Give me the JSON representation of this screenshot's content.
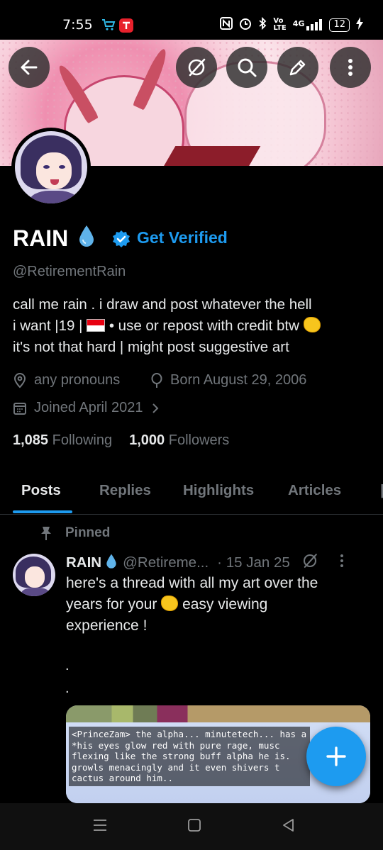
{
  "status_bar": {
    "time": "7:55",
    "network": "4G",
    "battery": "12",
    "icons": [
      "shopping-cart-icon",
      "app-notification-icon",
      "nfc-icon",
      "alarm-icon",
      "bluetooth-icon",
      "volte-icon",
      "signal-icon",
      "battery-icon",
      "charging-icon"
    ]
  },
  "header": {
    "buttons": [
      "back-button",
      "grok-button",
      "search-button",
      "edit-button",
      "more-button"
    ]
  },
  "profile": {
    "name": "RAIN",
    "get_verified": "Get Verified",
    "handle": "@RetirementRain",
    "bio_line1": "call me rain .   i draw and post whatever the hell",
    "bio_line2a": "i want |19 |",
    "bio_line2b": "• use or repost with credit btw",
    "bio_line3": "it's not that hard | might post suggestive art",
    "pronouns": "any pronouns",
    "born": "Born August 29, 2006",
    "joined": "Joined April 2021",
    "following_count": "1,085",
    "following_label": "Following",
    "followers_count": "1,000",
    "followers_label": "Followers"
  },
  "tabs": [
    {
      "label": "Posts"
    },
    {
      "label": "Replies"
    },
    {
      "label": "Highlights"
    },
    {
      "label": "Articles"
    }
  ],
  "post": {
    "pinned_label": "Pinned",
    "author": "RAIN",
    "handle": "@Retireme...",
    "date": "· 15 Jan 25",
    "text_line1": "here's a thread with all my art over the",
    "text_line2a": "years for your",
    "text_line2b": "easy viewing",
    "text_line3": "experience !",
    "dot1": ".",
    "dot2": ".",
    "media_chat": "<PrinceZam> the alpha... minutetech... has a\n*his eyes glow red with pure rage, musc\nflexing like the strong buff alpha he is.\ngrowls menacingly and it even shivers t\ncactus around him.."
  },
  "colors": {
    "accent": "#1d9bf0",
    "background": "#000000",
    "muted": "#71767b",
    "text": "#e7e9ea"
  }
}
